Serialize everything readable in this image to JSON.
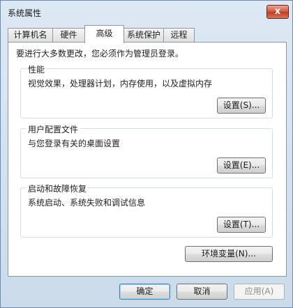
{
  "window": {
    "title": "系统属性",
    "close_glyph": "x"
  },
  "tabs": [
    {
      "label": "计算机名"
    },
    {
      "label": "硬件"
    },
    {
      "label": "高级"
    },
    {
      "label": "系统保护"
    },
    {
      "label": "远程"
    }
  ],
  "active_tab": "高级",
  "admin_note": "要进行大多数更改，您必须作为管理员登录。",
  "groups": {
    "performance": {
      "title": "性能",
      "desc": "视觉效果，处理器计划，内存使用，以及虚拟内存",
      "button": "设置(S)..."
    },
    "user_profiles": {
      "title": "用户配置文件",
      "desc": "与您登录有关的桌面设置",
      "button": "设置(E)..."
    },
    "startup_recovery": {
      "title": "启动和故障恢复",
      "desc": "系统启动、系统失败和调试信息",
      "button": "设置(T)..."
    }
  },
  "env_button": "环境变量(N)...",
  "footer": {
    "ok": "确定",
    "cancel": "取消",
    "apply": "应用(A)"
  }
}
